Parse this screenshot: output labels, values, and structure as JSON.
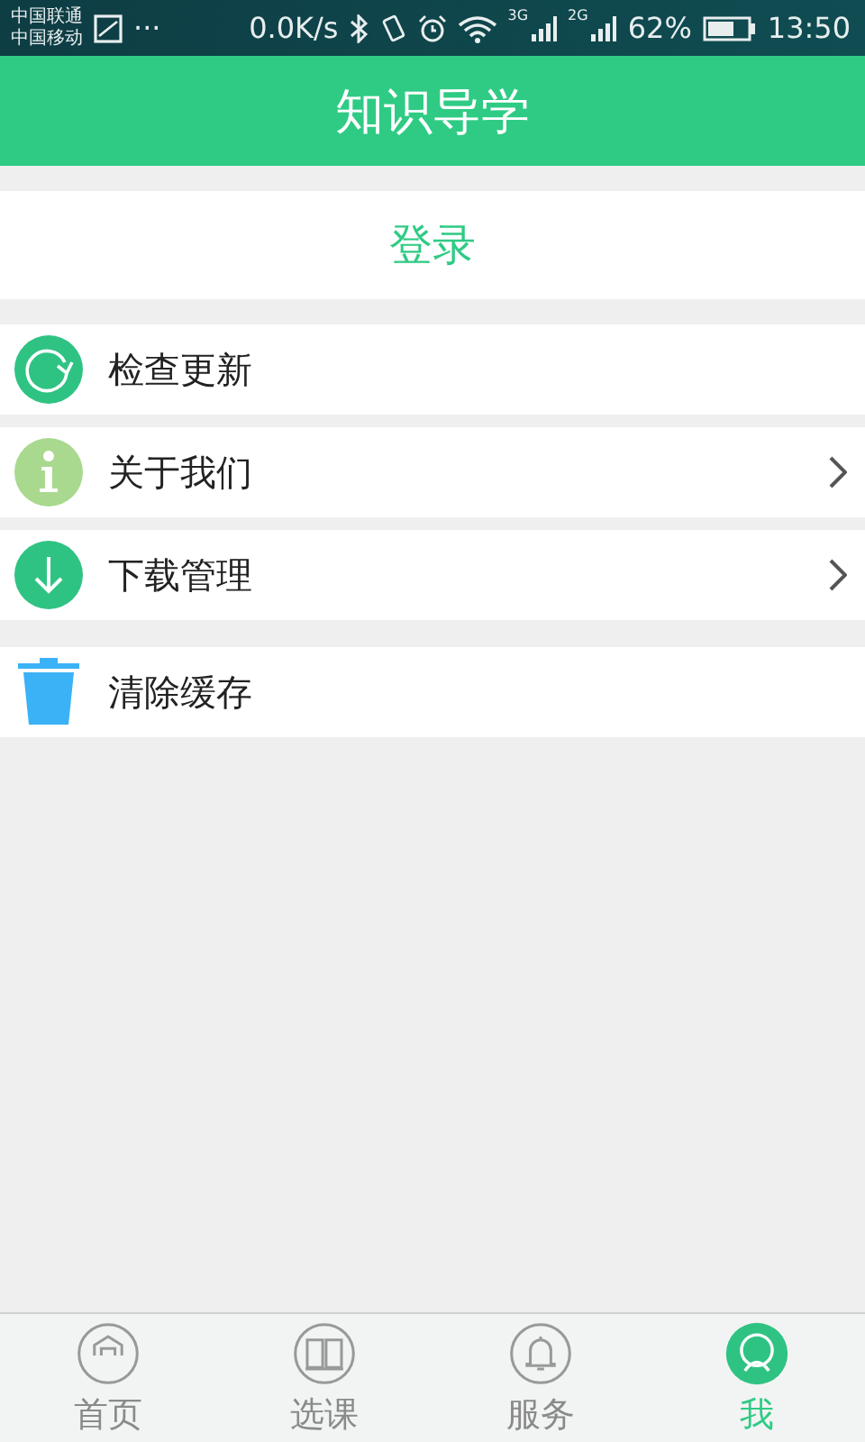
{
  "status_bar": {
    "carriers": [
      "中国联通",
      "中国移动"
    ],
    "more": "···",
    "speed": "0.0K/s",
    "network_1": "3G",
    "network_2": "2G",
    "battery": "62%",
    "time": "13:50"
  },
  "header": {
    "title": "知识导学"
  },
  "login": {
    "label": "登录"
  },
  "menu_groups": [
    [
      {
        "kind": "refresh",
        "label": "检查更新",
        "chevron": false
      },
      {
        "kind": "info",
        "label": "关于我们",
        "chevron": true
      },
      {
        "kind": "download",
        "label": "下载管理",
        "chevron": true
      }
    ],
    [
      {
        "kind": "trash",
        "label": "清除缓存",
        "chevron": false
      }
    ]
  ],
  "tabs": [
    {
      "kind": "home",
      "label": "首页",
      "selected": false
    },
    {
      "kind": "book",
      "label": "选课",
      "selected": false
    },
    {
      "kind": "bell",
      "label": "服务",
      "selected": false
    },
    {
      "kind": "user",
      "label": "我",
      "selected": true
    }
  ]
}
